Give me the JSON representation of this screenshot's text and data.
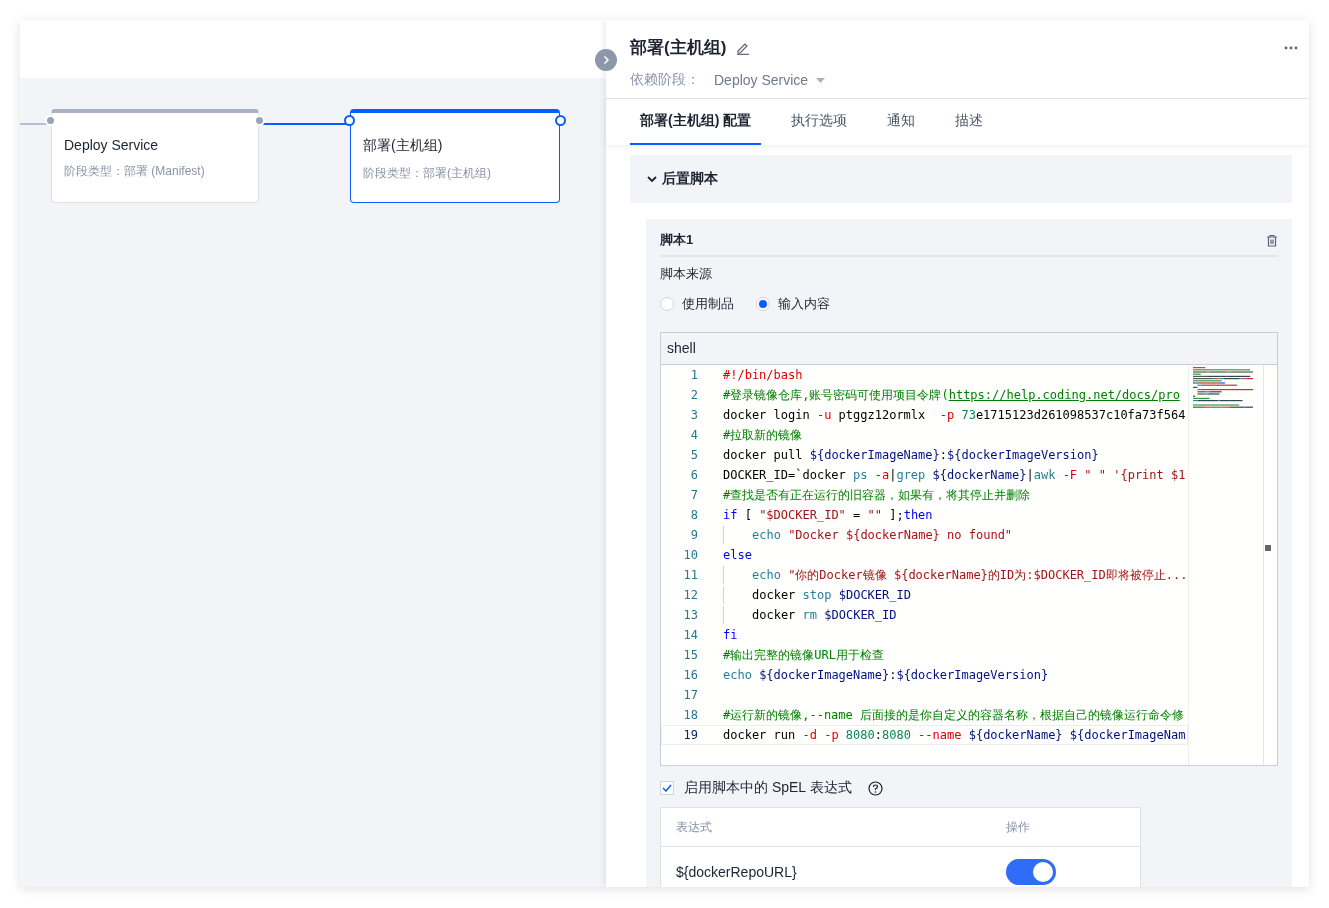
{
  "canvas": {
    "nodes": [
      {
        "title": "Deploy Service",
        "subtitle": "阶段类型：部署 (Manifest)",
        "selected": false
      },
      {
        "title": "部署(主机组)",
        "subtitle": "阶段类型：部署(主机组)",
        "selected": true
      }
    ]
  },
  "panel": {
    "title": "部署(主机组)",
    "dependency_label": "依赖阶段：",
    "dependency_value": "Deploy Service",
    "tabs": [
      {
        "label": "部署(主机组) 配置",
        "selected": true
      },
      {
        "label": "执行选项",
        "selected": false
      },
      {
        "label": "通知",
        "selected": false
      },
      {
        "label": "描述",
        "selected": false
      }
    ],
    "section": {
      "title": "后置脚本",
      "expanded": true
    },
    "script": {
      "title": "脚本1",
      "source_label": "脚本来源",
      "source_options": [
        {
          "label": "使用制品",
          "selected": false
        },
        {
          "label": "输入内容",
          "selected": true
        }
      ],
      "editor": {
        "language": "shell",
        "lines": [
          {
            "number": "1",
            "current": false,
            "guide": false,
            "tokens": [
              {
                "t": "#!/bin/bash",
                "kind": "flag"
              }
            ]
          },
          {
            "number": "2",
            "current": false,
            "guide": false,
            "tokens": [
              {
                "t": "#登录镜像仓库,账号密码可使用项目令牌(",
                "kind": "comment"
              },
              {
                "t": "https://help.coding.net/docs/pro",
                "kind": "link"
              }
            ]
          },
          {
            "number": "3",
            "current": false,
            "guide": false,
            "tokens": [
              {
                "t": "docker login ",
                "kind": "plain"
              },
              {
                "t": "-u",
                "kind": "flag"
              },
              {
                "t": " ptggz12ormlx  ",
                "kind": "plain"
              },
              {
                "t": "-p",
                "kind": "flag"
              },
              {
                "t": " 73",
                "kind": "number"
              },
              {
                "t": "e1715123d261098537c10fa73f564",
                "kind": "plain"
              }
            ]
          },
          {
            "number": "4",
            "current": false,
            "guide": false,
            "tokens": [
              {
                "t": "#拉取新的镜像",
                "kind": "comment"
              }
            ]
          },
          {
            "number": "5",
            "current": false,
            "guide": false,
            "tokens": [
              {
                "t": "docker pull ",
                "kind": "plain"
              },
              {
                "t": "${dockerImageName}",
                "kind": "var"
              },
              {
                "t": ":",
                "kind": "plain"
              },
              {
                "t": "${dockerImageVersion}",
                "kind": "var"
              }
            ]
          },
          {
            "number": "6",
            "current": false,
            "guide": false,
            "tokens": [
              {
                "t": "DOCKER_ID=`docker ",
                "kind": "plain"
              },
              {
                "t": "ps",
                "kind": "builtin"
              },
              {
                "t": " -a",
                "kind": "flag"
              },
              {
                "t": "|",
                "kind": "plain"
              },
              {
                "t": "grep",
                "kind": "builtin"
              },
              {
                "t": " ${dockerName}",
                "kind": "var"
              },
              {
                "t": "|",
                "kind": "plain"
              },
              {
                "t": "awk",
                "kind": "builtin"
              },
              {
                "t": " -F",
                "kind": "flag"
              },
              {
                "t": " \" \" '{print $1",
                "kind": "string"
              }
            ]
          },
          {
            "number": "7",
            "current": false,
            "guide": false,
            "tokens": [
              {
                "t": "#查找是否有正在运行的旧容器，如果有，将其停止并删除",
                "kind": "comment"
              }
            ]
          },
          {
            "number": "8",
            "current": false,
            "guide": false,
            "tokens": [
              {
                "t": "if",
                "kind": "keyword"
              },
              {
                "t": " [ ",
                "kind": "plain"
              },
              {
                "t": "\"$DOCKER_ID\"",
                "kind": "string"
              },
              {
                "t": " = ",
                "kind": "plain"
              },
              {
                "t": "\"\"",
                "kind": "string"
              },
              {
                "t": " ];",
                "kind": "plain"
              },
              {
                "t": "then",
                "kind": "keyword"
              }
            ]
          },
          {
            "number": "9",
            "current": false,
            "guide": true,
            "tokens": [
              {
                "t": "echo",
                "kind": "builtin"
              },
              {
                "t": " \"Docker ${dockerName} no found\"",
                "kind": "string"
              }
            ]
          },
          {
            "number": "10",
            "current": false,
            "guide": false,
            "tokens": [
              {
                "t": "else",
                "kind": "keyword"
              }
            ]
          },
          {
            "number": "11",
            "current": false,
            "guide": true,
            "tokens": [
              {
                "t": "echo",
                "kind": "builtin"
              },
              {
                "t": " \"你的Docker镜像 ${dockerName}的ID为:$DOCKER_ID即将被停止...",
                "kind": "string"
              }
            ]
          },
          {
            "number": "12",
            "current": false,
            "guide": true,
            "tokens": [
              {
                "t": "docker ",
                "kind": "plain"
              },
              {
                "t": "stop",
                "kind": "builtin"
              },
              {
                "t": " $DOCKER_ID",
                "kind": "var"
              }
            ]
          },
          {
            "number": "13",
            "current": false,
            "guide": true,
            "tokens": [
              {
                "t": "docker ",
                "kind": "plain"
              },
              {
                "t": "rm",
                "kind": "builtin"
              },
              {
                "t": " $DOCKER_ID",
                "kind": "var"
              }
            ]
          },
          {
            "number": "14",
            "current": false,
            "guide": false,
            "tokens": [
              {
                "t": "fi",
                "kind": "keyword"
              }
            ]
          },
          {
            "number": "15",
            "current": false,
            "guide": false,
            "tokens": [
              {
                "t": "#输出完整的镜像URL用于检查",
                "kind": "comment"
              }
            ]
          },
          {
            "number": "16",
            "current": false,
            "guide": false,
            "tokens": [
              {
                "t": "echo",
                "kind": "builtin"
              },
              {
                "t": " ${dockerImageName}",
                "kind": "var"
              },
              {
                "t": ":",
                "kind": "plain"
              },
              {
                "t": "${dockerImageVersion}",
                "kind": "var"
              }
            ]
          },
          {
            "number": "17",
            "current": false,
            "guide": false
          },
          {
            "number": "18",
            "current": false,
            "guide": false,
            "tokens": [
              {
                "t": "#运行新的镜像,--name 后面接的是你自定义的容器名称，根据自己的镜像运行命令修",
                "kind": "comment"
              }
            ]
          },
          {
            "number": "19",
            "current": true,
            "guide": false,
            "tokens": [
              {
                "t": "docker run ",
                "kind": "plain"
              },
              {
                "t": "-d -p",
                "kind": "flag"
              },
              {
                "t": " 8080",
                "kind": "number"
              },
              {
                "t": ":",
                "kind": "plain"
              },
              {
                "t": "8080",
                "kind": "number"
              },
              {
                "t": " --name",
                "kind": "flag"
              },
              {
                "t": " ${dockerName}",
                "kind": "var"
              },
              {
                "t": " ${dockerImageNam",
                "kind": "var"
              }
            ]
          }
        ]
      },
      "spel": {
        "label": "启用脚本中的 SpEL 表达式",
        "checked": true
      },
      "table": {
        "columns": [
          "表达式",
          "操作"
        ],
        "rows": [
          {
            "expression": "${dockerRepoURL}",
            "on": true
          }
        ]
      }
    }
  }
}
